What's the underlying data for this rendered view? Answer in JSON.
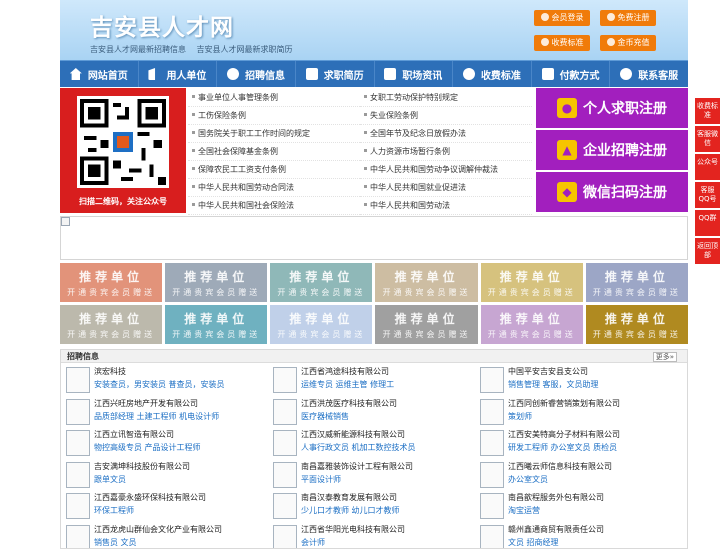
{
  "header": {
    "title": "吉安县人才网",
    "sub_links": [
      "吉安县人才网最新招聘信息",
      "吉安县人才网最新求职简历"
    ],
    "buttons": [
      {
        "label": "会员登录",
        "icon": "user-icon"
      },
      {
        "label": "免费注册",
        "icon": "register-icon"
      },
      {
        "label": "收费标准",
        "icon": "yen-icon"
      },
      {
        "label": "金币充值",
        "icon": "coin-icon"
      }
    ]
  },
  "nav": [
    {
      "label": "网站首页",
      "icon": "home-icon"
    },
    {
      "label": "用人单位",
      "icon": "building-icon"
    },
    {
      "label": "招聘信息",
      "icon": "chat-icon"
    },
    {
      "label": "求职简历",
      "icon": "resume-icon"
    },
    {
      "label": "职场资讯",
      "icon": "news-icon"
    },
    {
      "label": "收费标准",
      "icon": "yen-icon"
    },
    {
      "label": "付款方式",
      "icon": "card-icon"
    },
    {
      "label": "联系客服",
      "icon": "phone-icon"
    }
  ],
  "qr": {
    "caption": "扫描二维码，关注公众号"
  },
  "policy_links": [
    "事业单位人事管理条例",
    "女职工劳动保护特别规定",
    "工伤保险条例",
    "失业保险条例",
    "国务院关于职工工作时间的规定",
    "全国年节及纪念日放假办法",
    "全国社会保障基金条例",
    "人力资源市场暂行条例",
    "保障农民工工资支付条例",
    "中华人民共和国劳动争议调解仲裁法",
    "中华人民共和国劳动合同法",
    "中华人民共和国就业促进法",
    "中华人民共和国社会保险法",
    "中华人民共和国劳动法"
  ],
  "register_buttons": [
    "个人求职注册",
    "企业招聘注册",
    "微信扫码注册"
  ],
  "recommend": {
    "title": "推荐单位",
    "subtitle": "开通贵宾会员赠送",
    "colors": [
      "#e2937a",
      "#9eaab8",
      "#8fb8b8",
      "#cdbda2",
      "#d6c27e",
      "#9ca6c6",
      "#bcb9ac",
      "#6fb1c0",
      "#c0d0e9",
      "#a0a0a0",
      "#c7a6d2",
      "#b08a20"
    ]
  },
  "jobs": {
    "header": "招聘信息",
    "more": "更多»",
    "items": [
      {
        "company": "滨宏科技",
        "positions": "安装查员，男安装员 普查员，安装员"
      },
      {
        "company": "江西省鸿途科技有限公司",
        "positions": "运维专员 运维主管 修理工"
      },
      {
        "company": "中国平安吉安县支公司",
        "positions": "销售管理 客服，文员助理"
      },
      {
        "company": "江西兴旺房地产开发有限公司",
        "positions": "品质部经理 土建工程师 机电设计师"
      },
      {
        "company": "江西洪茂医疗科技有限公司",
        "positions": "医疗器械销售"
      },
      {
        "company": "江西同创新睿营销策划有限公司",
        "positions": "策划师"
      },
      {
        "company": "江西立讯智造有限公司",
        "positions": "物控高级专员 产品设计工程师"
      },
      {
        "company": "江西汉威新能源科技有限公司",
        "positions": "人事行政文员 机加工数控技术员"
      },
      {
        "company": "江西安美特高分子材料有限公司",
        "positions": "研发工程师 办公室文员 质检员"
      },
      {
        "company": "吉安满坤科技股份有限公司",
        "positions": "跟单文员"
      },
      {
        "company": "南昌嘉雅装饰设计工程有限公司",
        "positions": "平面设计师"
      },
      {
        "company": "江西曦云师信息科技有限公司",
        "positions": "办公室文员"
      },
      {
        "company": "江西嘉豪永盛环保科技有限公司",
        "positions": "环保工程师"
      },
      {
        "company": "南昌汉泰教育发展有限公司",
        "positions": "少儿口才教师 幼儿口才教师"
      },
      {
        "company": "南昌歆程服务外包有限公司",
        "positions": "淘宝运营"
      },
      {
        "company": "江西龙虎山群仙会文化产业有限公司",
        "positions": "销售员 文员"
      },
      {
        "company": "江西省华阳光电科技有限公司",
        "positions": "会计师"
      },
      {
        "company": "赣州鑫通商贸有限责任公司",
        "positions": "文员 招商经理"
      }
    ]
  },
  "side_buttons": [
    "收费标准",
    "客服微信",
    "公众号",
    "客服QQ号",
    "QQ群",
    "返回顶部"
  ]
}
